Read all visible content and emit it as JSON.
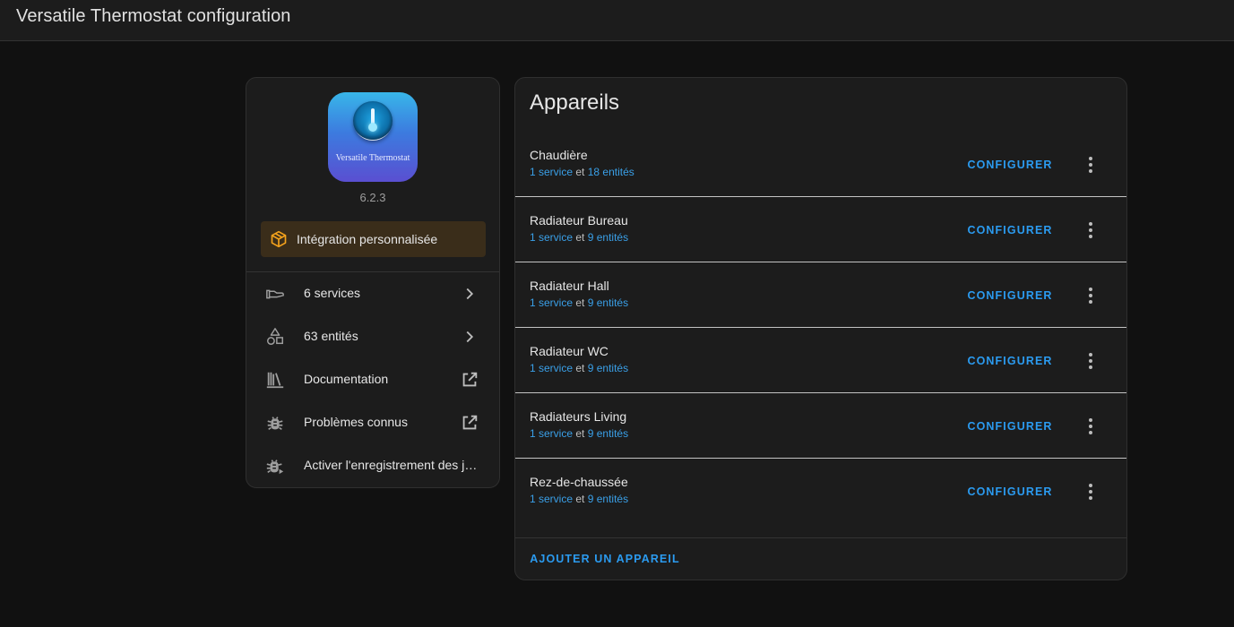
{
  "header": {
    "title": "Versatile Thermostat configuration"
  },
  "integration": {
    "logo_text": "Versatile Thermostat",
    "version": "6.2.3",
    "custom_badge": "Intégration personnalisée",
    "links": [
      {
        "label": "6 services",
        "icon": "service-hand-icon",
        "trailing": "chevron-right-icon"
      },
      {
        "label": "63 entités",
        "icon": "shapes-icon",
        "trailing": "chevron-right-icon"
      },
      {
        "label": "Documentation",
        "icon": "bookshelf-icon",
        "trailing": "open-in-new-icon"
      },
      {
        "label": "Problèmes connus",
        "icon": "bug-icon",
        "trailing": "open-in-new-icon"
      },
      {
        "label": "Activer l'enregistrement des journaux de débogage",
        "icon": "bug-play-icon",
        "trailing": ""
      }
    ]
  },
  "devices": {
    "title": "Appareils",
    "configure_label": "CONFIGURER",
    "conjunction": "et",
    "items": [
      {
        "name": "Chaudière",
        "services": "1 service",
        "entities": "18 entités"
      },
      {
        "name": "Radiateur Bureau",
        "services": "1 service",
        "entities": "9 entités"
      },
      {
        "name": "Radiateur Hall",
        "services": "1 service",
        "entities": "9 entités"
      },
      {
        "name": "Radiateur WC",
        "services": "1 service",
        "entities": "9 entités"
      },
      {
        "name": "Radiateurs Living",
        "services": "1 service",
        "entities": "9 entités"
      },
      {
        "name": "Rez-de-chaussée",
        "services": "1 service",
        "entities": "9 entités"
      }
    ],
    "add_label": "AJOUTER UN APPAREIL"
  },
  "colors": {
    "accent": "#2b9bf0",
    "link": "#3aa0e8",
    "badge_bg": "#3a2d1a",
    "badge_icon": "#f4a21c"
  }
}
